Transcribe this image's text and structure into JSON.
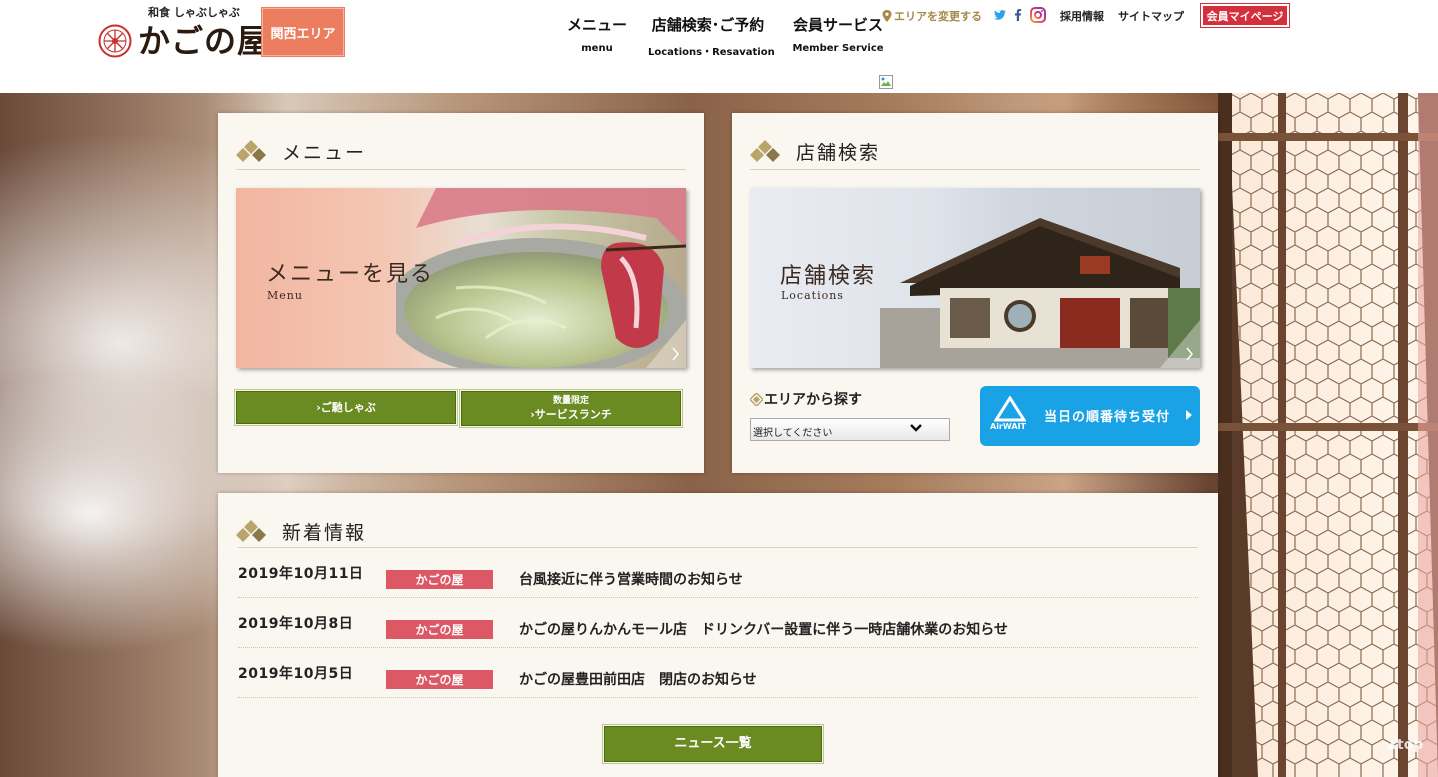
{
  "header": {
    "logo_sub": "和食 しゃぶしゃぶ",
    "logo_name": "かごの屋",
    "area_badge": "関西エリア",
    "nav": [
      {
        "jp": "メニュー",
        "en": "menu"
      },
      {
        "jp": "店舗検索･ご予約",
        "en": "Locations・Resavation"
      },
      {
        "jp": "会員サービス",
        "en": "Member Service"
      }
    ],
    "area_change": "エリアを変更する",
    "social_icons": [
      "twitter-icon",
      "facebook-icon",
      "instagram-icon"
    ],
    "links": [
      "採用情報",
      "サイトマップ"
    ],
    "mypage": "会員マイページ"
  },
  "menu_panel": {
    "title": "メニュー",
    "banner_title": "メニューを見る",
    "banner_sub": "Menu",
    "buttons": [
      {
        "line1": "",
        "line2": "›ご馳しゃぶ"
      },
      {
        "line1": "数量限定",
        "line2": "›サービスランチ"
      }
    ]
  },
  "store_panel": {
    "title": "店舗検索",
    "banner_title": "店舗検索",
    "banner_sub": "Locations",
    "area_search_label": "エリアから探す",
    "select_value": "選択してください",
    "airwait_brand": "AirWAIT",
    "airwait_text": "当日の順番待ち受付"
  },
  "news_panel": {
    "title": "新着情報",
    "items": [
      {
        "date": "2019年10月11日",
        "category": "かごの屋",
        "title": "台風接近に伴う営業時間のお知らせ"
      },
      {
        "date": "2019年10月8日",
        "category": "かごの屋",
        "title": "かごの屋りんかんモール店　ドリンクバー設置に伴う一時店舗休業のお知らせ"
      },
      {
        "date": "2019年10月5日",
        "category": "かごの屋",
        "title": "かごの屋豊田前田店　閉店のお知らせ"
      }
    ],
    "list_button": "ニュース一覧"
  },
  "to_top": "top",
  "colors": {
    "brand_orange": "#ec7d5f",
    "mypage_red": "#d4303b",
    "button_green": "#6a8a22",
    "category_pink": "#dc5864",
    "airwait_blue": "#19a3e6",
    "gold": "#a58a4a"
  }
}
